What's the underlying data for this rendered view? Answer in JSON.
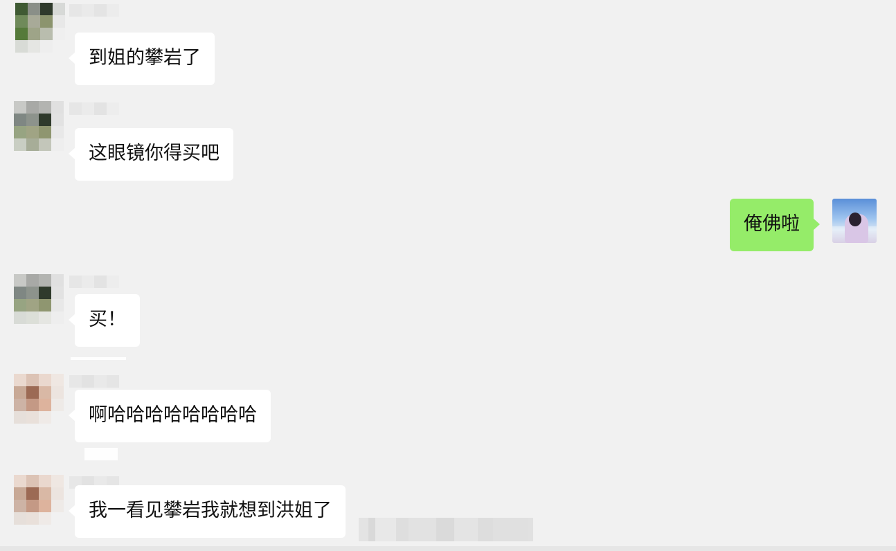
{
  "messages": [
    {
      "side": "left",
      "text": "到姐的攀岩了"
    },
    {
      "side": "left",
      "text": "这眼镜你得买吧"
    },
    {
      "side": "right",
      "text": "俺佛啦"
    },
    {
      "side": "left",
      "text": "买！"
    },
    {
      "side": "left",
      "text": "啊哈哈哈哈哈哈哈哈"
    },
    {
      "side": "left",
      "text": "我一看见攀岩我就想到洪姐了"
    }
  ],
  "colors": {
    "background": "#f1f1f1",
    "incoming_bubble": "#ffffff",
    "outgoing_bubble": "#95ec69",
    "text": "#111111"
  },
  "icons": {
    "sender_avatar": "pixelated-avatar-icon",
    "self_avatar": "photo-avatar-icon"
  }
}
